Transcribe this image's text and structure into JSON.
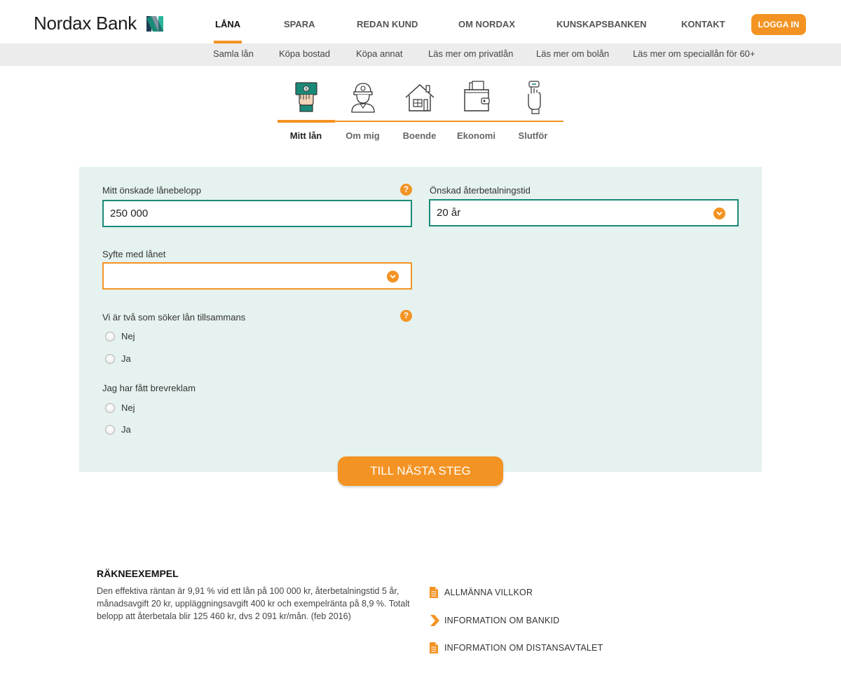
{
  "brand": {
    "name": "Nordax Bank",
    "accent_color": "#f39323",
    "teal_color": "#1a8a78",
    "panel_color": "#e5f2ef"
  },
  "header": {
    "nav": [
      {
        "label": "LÅNA",
        "active": true
      },
      {
        "label": "SPARA",
        "active": false
      },
      {
        "label": "REDAN KUND",
        "active": false
      },
      {
        "label": "OM NORDAX",
        "active": false
      },
      {
        "label": "KUNSKAPSBANKEN",
        "active": false
      },
      {
        "label": "KONTAKT",
        "active": false
      }
    ],
    "login_label": "LOGGA IN"
  },
  "subnav": [
    {
      "label": "Samla lån"
    },
    {
      "label": "Köpa bostad"
    },
    {
      "label": "Köpa annat"
    },
    {
      "label": "Läs mer om privatlån"
    },
    {
      "label": "Läs mer om bolån"
    },
    {
      "label": "Läs mer om speciallån för 60+"
    }
  ],
  "steps": [
    {
      "label": "Mitt lån",
      "icon": "money-hand-icon",
      "active": true
    },
    {
      "label": "Om mig",
      "icon": "person-helmet-icon",
      "active": false
    },
    {
      "label": "Boende",
      "icon": "house-icon",
      "active": false
    },
    {
      "label": "Ekonomi",
      "icon": "wallet-icon",
      "active": false
    },
    {
      "label": "Slutför",
      "icon": "hand-sign-icon",
      "active": false
    }
  ],
  "form": {
    "amount": {
      "label": "Mitt önskade lånebelopp",
      "value": "250 000"
    },
    "term": {
      "label": "Önskad återbetalningstid",
      "value": "20 år"
    },
    "purpose": {
      "label": "Syfte med lånet",
      "value": ""
    },
    "joint": {
      "label": "Vi är två som söker lån tillsammans",
      "options": [
        "Nej",
        "Ja"
      ]
    },
    "mail": {
      "label": "Jag har fått brevreklam",
      "options": [
        "Nej",
        "Ja"
      ]
    },
    "help_glyph": "?",
    "next_label": "TILL NÄSTA STEG"
  },
  "example": {
    "title": "RÄKNEEXEMPEL",
    "text": "Den effektiva räntan är 9,91 % vid ett lån på 100 000 kr, återbetalningstid 5 år, månadsavgift 20 kr, uppläggningsavgift 400 kr och exempelränta på 8,9 %. Totalt belopp att återbetala blir 125 460 kr, dvs 2 091 kr/mån. (feb 2016)"
  },
  "links": [
    {
      "label": "ALLMÄNNA VILLKOR",
      "icon": "document-icon"
    },
    {
      "label": "INFORMATION OM BANKID",
      "icon": "chevron-right-icon"
    },
    {
      "label": "INFORMATION OM DISTANSAVTALET",
      "icon": "document-icon"
    }
  ]
}
